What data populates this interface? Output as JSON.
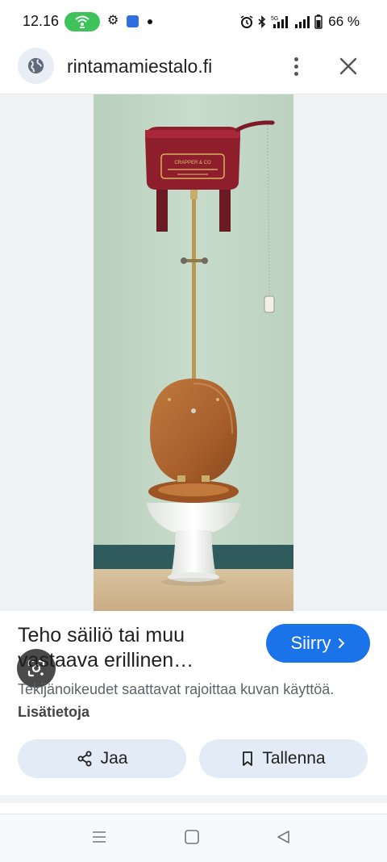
{
  "status_bar": {
    "time": "12.16",
    "battery_text": "66 %",
    "network": "5G",
    "hotspot_color": "#3fc25a",
    "icons": [
      "hotspot-icon",
      "gear-icon",
      "app-notification-icon",
      "alarm-icon",
      "bluetooth-icon",
      "signal-icon",
      "battery-icon"
    ]
  },
  "url_bar": {
    "site": "rintamamiestalo.fi",
    "icons": [
      "globe-icon",
      "more-vert-icon",
      "close-icon"
    ]
  },
  "image": {
    "subject": "toilet-with-high-tank-illustration",
    "tank_plate_text": "CRAPPER & CO"
  },
  "info": {
    "title_line1": "Teho säiliö tai muu",
    "title_line2": "vastaava erillinen…",
    "goto_label": "Siirry",
    "goto_color": "#1a73e8",
    "copyright_text": "Tekijänoikeudet saattavat rajoittaa kuvan käyttöä.",
    "learn_more": "Lisätietoja"
  },
  "actions": {
    "share_label": "Jaa",
    "save_label": "Tallenna",
    "pill_color": "#e3ebf7"
  },
  "nav_bar": {
    "icons": [
      "recents-icon",
      "home-icon",
      "back-icon"
    ]
  }
}
